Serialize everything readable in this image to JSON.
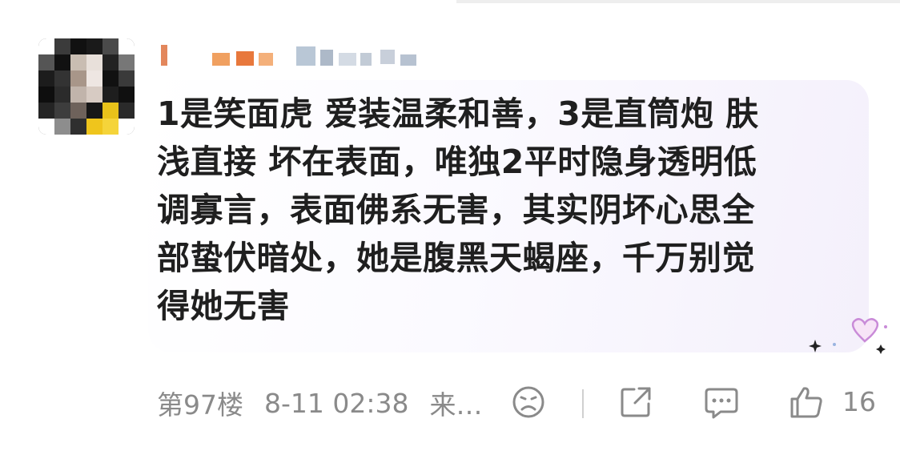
{
  "comment": {
    "lines": [
      "1是笑面虎 爱装温柔和善，3是直筒炮 肤",
      "浅直接 坏在表面，唯独2平时隐身透明低",
      "调寡言，表面佛系无害，其实阴坏心思全",
      "部蛰伏暗处，她是腹黑天蝎座，千万别觉",
      "得她无害"
    ]
  },
  "footer": {
    "floor": "第97楼",
    "datetime": "8-11 02:38",
    "source": "来…",
    "like_count": "16"
  },
  "icons": {
    "reaction": "face-frown-icon",
    "share": "share-icon",
    "reply": "comment-bubble-icon",
    "like": "thumbs-up-icon",
    "sticker": "heart-sparkle-icon"
  },
  "colors": {
    "text": "#1f1f1f",
    "meta": "#8a8a8a",
    "bubble_tint": "#f4f0fb"
  }
}
